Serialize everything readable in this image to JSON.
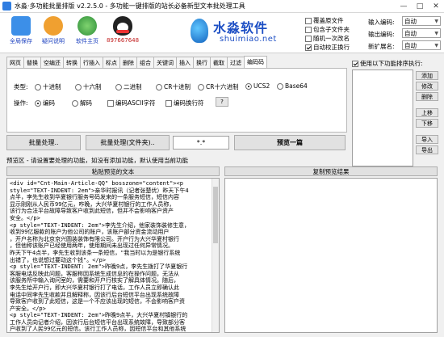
{
  "window": {
    "title": "水淼·多功能批量排版 v2.2.5.0 - 多功能一键排版的站长必备新型文本批处理工具",
    "controls": [
      "—",
      "□",
      "✕"
    ]
  },
  "toolbar": {
    "buttons": [
      {
        "label": "全局保存",
        "icon": "save-icon",
        "color": "#3c8fe8"
      },
      {
        "label": "疑问说明",
        "icon": "help-icon",
        "color": "#f0a030"
      },
      {
        "label": "软件主页",
        "icon": "home-icon",
        "color": "#3bb44a"
      },
      {
        "label": "897667648",
        "icon": "qq-icon",
        "color": "#222222"
      }
    ],
    "logo": {
      "cn": "水淼软件",
      "en": "shuimiao.net",
      "color": "#1d4fc4"
    }
  },
  "options": {
    "checkboxes": [
      {
        "label": "覆盖原文件",
        "checked": false
      },
      {
        "label": "包含子文件夹",
        "checked": false
      },
      {
        "label": "随机一次改名",
        "checked": false
      },
      {
        "label": "自动校正换行",
        "checked": true
      }
    ],
    "fields": [
      {
        "label": "输入编码:",
        "value": "自动"
      },
      {
        "label": "输出编码:",
        "value": "自动"
      },
      {
        "label": "新扩展名:",
        "value": "自动"
      }
    ]
  },
  "tabs": [
    "网页",
    "替换",
    "空编还",
    "转换",
    "行插入",
    "标点",
    "删除",
    "组合",
    "关键词",
    "插入",
    "换行",
    "截取",
    "过滤",
    "编码码"
  ],
  "active_tab": 13,
  "encode_panel": {
    "type_label": "类型:",
    "types": [
      {
        "label": "十进制",
        "selected": false
      },
      {
        "label": "十六制",
        "selected": false
      },
      {
        "label": "二进制",
        "selected": false
      },
      {
        "label": "CR十进制",
        "selected": false
      },
      {
        "label": "CR十六进制",
        "selected": false
      },
      {
        "label": "UCS2",
        "selected": true
      },
      {
        "label": "Base64",
        "selected": false
      }
    ],
    "op_label": "操作:",
    "ops": [
      {
        "label": "编码",
        "selected": true
      },
      {
        "label": "解码",
        "selected": false
      }
    ],
    "op_checks": [
      {
        "label": "编码ASCII字符",
        "checked": false
      },
      {
        "label": "编码换行符",
        "checked": false
      }
    ],
    "help_button": "?"
  },
  "sequence": {
    "checkbox_label": "使用以下功能排序执行:",
    "checked": true,
    "buttons": [
      "添加",
      "修改",
      "删除",
      "上移",
      "下移",
      "导入",
      "导出"
    ]
  },
  "actions": {
    "batch": "批量处理..",
    "batch_file": "批量处理(文件夹)..",
    "ext_value": "*.*",
    "preview": "预览一篇"
  },
  "preview": {
    "notice": "预览区 - 请设置要处理的功能，如没有添加功能，默认使用当前功能",
    "paste_button": "粘贴预览的文本",
    "copy_button": "复制预览结果",
    "source_lines": [
      "<div id=\"Cnt-Main-Article-QQ\" bosszone=\"content\"><p",
      "style=\"TEXT-INDENT: 2em\">亲华时报讯（记者张楚优）昨天下午4",
      "点半，李先生收到华夏银行服务号码发来的一条服务短信，短信内容",
      "显示刚刚从人民币99亿元，咋晚，大兴华夏村银行的工作人员称，",
      "该行为合法平台故障导致客户收到此短信，但并不会影响客户资产",
      "安全。</p>",
      "<p style=\"TEXT-INDENT: 2em\">李先生介绍，他家装饰装修生意，",
      "收到99亿服款的账户为他公司的账户，该账户部分资金流动用户",
      "，开户名称为北京京兴圆装装饰有限公司。开户行为大兴华夏村银行",
      "，但他称该账户已经使用两年，使用期间未出现过任何异常情况。",
      "昨天下午4点半，李先生收到该条一条短信，\"我当时以为是银行系统",
      "出错了，也说想过要动这个钱\"。</p>",
      "<p style=\"TEXT-INDENT: 2em\">昨晚9点，李先生拨打了华夏银行",
      "客服电话反映此问题，客服称因系统生成信息的在操作问题，无法从",
      "该服务所中输入询问室的，需要和开户行核实了解具体情况。随后，",
      "李先生给开户行，即大兴华夏村银行打了电话，工作人员立即确认此",
      "电话中同李先生收款并且解释称，因该行后台短信平台出现系统故障",
      "导致客户收到了此短信，这是一个不应该出现的短信，不会影响客户资",
      "产安全。</p>",
      "<p style=\"TEXT-INDENT: 2em\">昨晚9点半，大兴华夏村镇银行的",
      "工作人员向记者介绍，因该行后台短信平台出现系统故障，导致部分客",
      "户收到了人民99亿元的短信。该行工作人员称，因短信平台和其他系统"
    ],
    "result_lines": []
  }
}
